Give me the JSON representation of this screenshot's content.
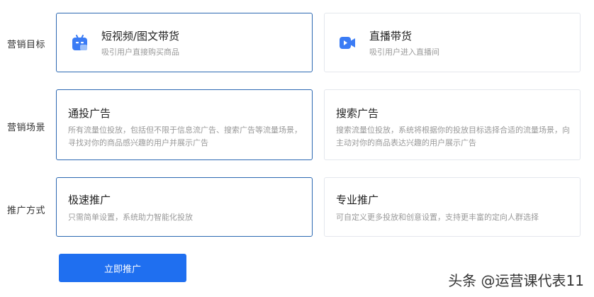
{
  "rows": {
    "goal": {
      "label": "营销目标"
    },
    "scene": {
      "label": "营销场景"
    },
    "method": {
      "label": "推广方式"
    }
  },
  "goal_options": [
    {
      "title": "短视频/图文带货",
      "desc": "吸引用户直接购买商品",
      "icon": "video-image-icon",
      "selected": true
    },
    {
      "title": "直播带货",
      "desc": "吸引用户进入直播间",
      "icon": "live-camera-icon",
      "selected": false
    }
  ],
  "scene_options": [
    {
      "title": "通投广告",
      "desc": "所有流量位投放，包括但不限于信息流广告、搜索广告等流量场景，寻找对你的商品感兴趣的用户并展示广告",
      "selected": true
    },
    {
      "title": "搜索广告",
      "desc": "搜索流量位投放，系统将根据你的投放目标选择合适的流量场景，向主动对你的商品表达兴趣的用户展示广告",
      "selected": false
    }
  ],
  "method_options": [
    {
      "title": "极速推广",
      "desc": "只需简单设置，系统助力智能化投放",
      "selected": true
    },
    {
      "title": "专业推广",
      "desc": "可自定义更多投放和创意设置，支持更丰富的定向人群选择",
      "selected": false
    }
  ],
  "submit": {
    "label": "立即推广"
  },
  "watermark": {
    "text": "头条 @运营课代表11"
  },
  "colors": {
    "accent": "#1f6ff0",
    "selected_border": "#2c68b2",
    "border": "#e4e7ed",
    "icon_blue": "#3b7cf5"
  }
}
